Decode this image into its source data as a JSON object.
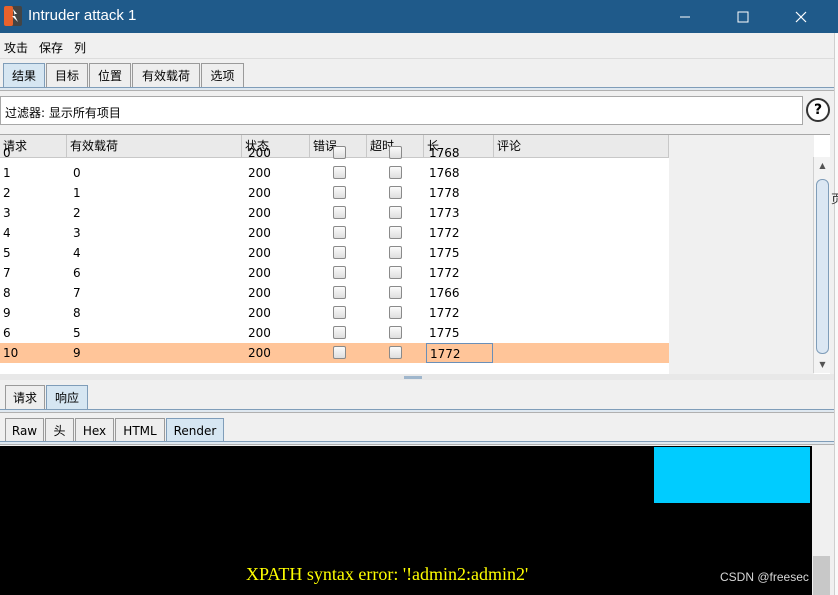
{
  "window": {
    "title": "Intruder attack 1",
    "titlebar_color": "#1f5a8a",
    "minimize_icon": "minimize-icon",
    "maximize_icon": "maximize-icon",
    "close_icon": "close-icon"
  },
  "menu": [
    "攻击",
    "保存",
    "列"
  ],
  "main_tabs": [
    "结果",
    "目标",
    "位置",
    "有效载荷",
    "选项"
  ],
  "active_main_tab": "结果",
  "filter": {
    "text": "过滤器:  显示所有项目",
    "help_glyph": "?"
  },
  "table": {
    "columns": [
      "请求",
      "有效载荷",
      "状态",
      "错误",
      "超时",
      "长",
      "评论"
    ],
    "rows": [
      {
        "request": "0",
        "payload": "",
        "status": "200",
        "length": "1768"
      },
      {
        "request": "1",
        "payload": "0",
        "status": "200",
        "length": "1768"
      },
      {
        "request": "2",
        "payload": "1",
        "status": "200",
        "length": "1778"
      },
      {
        "request": "3",
        "payload": "2",
        "status": "200",
        "length": "1773"
      },
      {
        "request": "4",
        "payload": "3",
        "status": "200",
        "length": "1772"
      },
      {
        "request": "5",
        "payload": "4",
        "status": "200",
        "length": "1775"
      },
      {
        "request": "7",
        "payload": "6",
        "status": "200",
        "length": "1772"
      },
      {
        "request": "8",
        "payload": "7",
        "status": "200",
        "length": "1766"
      },
      {
        "request": "9",
        "payload": "8",
        "status": "200",
        "length": "1772"
      },
      {
        "request": "6",
        "payload": "5",
        "status": "200",
        "length": "1775"
      },
      {
        "request": "10",
        "payload": "9",
        "status": "200",
        "length": "1772",
        "selected": true
      }
    ],
    "selected_row_color": "#ffc599"
  },
  "detail_tabs": [
    "请求",
    "响应"
  ],
  "active_detail_tab": "响应",
  "view_tabs": [
    "Raw",
    "头",
    "Hex",
    "HTML",
    "Render"
  ],
  "active_view_tab": "Render",
  "render": {
    "error_text": "XPATH syntax error: '!admin2:admin2'",
    "error_color": "#ffff00",
    "box_color": "#00ccff"
  },
  "watermark": "CSDN @freesec",
  "edge_char": "页"
}
